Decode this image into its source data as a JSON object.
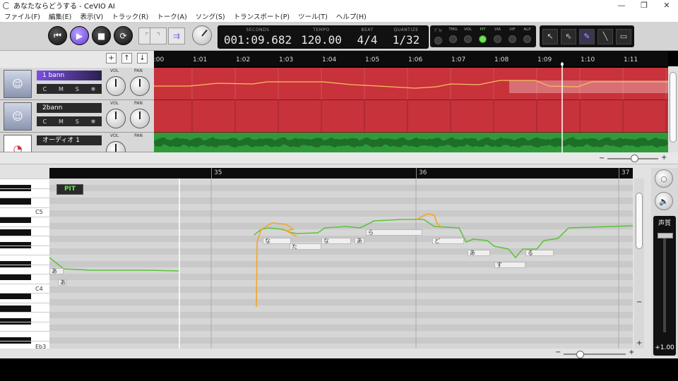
{
  "window": {
    "title": "あなたならどうする - CeVIO AI",
    "minimize": "—",
    "maximize": "❐",
    "close": "✕"
  },
  "menu": [
    "ファイル(F)",
    "編集(E)",
    "表示(V)",
    "トラック(R)",
    "トーク(A)",
    "ソング(S)",
    "トランスポート(P)",
    "ツール(T)",
    "ヘルプ(H)"
  ],
  "transport": {
    "seconds_label": "SECONDS",
    "seconds": "001:09.682",
    "tempo_label": "TEMPO",
    "tempo": "120.00",
    "beat_label": "BEAT",
    "beat": "4/4",
    "quantize_label": "QUANTIZE",
    "quantize": "1/32"
  },
  "toggles": [
    {
      "label": "ﾃﾞﾌｫ",
      "on": false
    },
    {
      "label": "TMG",
      "on": false
    },
    {
      "label": "VOL",
      "on": false
    },
    {
      "label": "PIT",
      "on": true
    },
    {
      "label": "VIA",
      "on": false
    },
    {
      "label": "VIF",
      "on": false
    },
    {
      "label": "ALP",
      "on": false
    }
  ],
  "track_buttons": {
    "add": "+",
    "up": "↑",
    "down": "↓"
  },
  "ruler": [
    "1:00",
    "1:01",
    "1:02",
    "1:03",
    "1:04",
    "1:05",
    "1:06",
    "1:07",
    "1:08",
    "1:09",
    "1:10",
    "1:11"
  ],
  "tracks": [
    {
      "name": "1 bann",
      "selected": true,
      "vol": "VOL",
      "pan": "PAN"
    },
    {
      "name": "2bann",
      "selected": false,
      "vol": "VOL",
      "pan": "PAN"
    },
    {
      "name": "オーディオ 1",
      "selected": false,
      "vol": "VOL",
      "pan": "PAN"
    }
  ],
  "track_controls": {
    "c": "C",
    "m": "M",
    "s": "S"
  },
  "roll": {
    "measures": [
      "35",
      "36",
      "37"
    ],
    "mode": "PIT",
    "key_labels": [
      "C5",
      "C4",
      "Eb3"
    ],
    "notes": [
      {
        "lyric": "あ"
      },
      {
        "lyric": "あ"
      },
      {
        "lyric": "な"
      },
      {
        "lyric": "た"
      },
      {
        "lyric": "な"
      },
      {
        "lyric": "あ"
      },
      {
        "lyric": "ら"
      },
      {
        "lyric": "ど"
      },
      {
        "lyric": "あ"
      },
      {
        "lyric": "す"
      },
      {
        "lyric": "る"
      }
    ]
  },
  "quality": {
    "label": "声質",
    "value": "+1.00"
  },
  "colors": {
    "track_red": "#c8323a",
    "track_green": "#2f9a3a",
    "pitch_line": "#5cc43c",
    "pitch_edit": "#f2a62a",
    "accent": "#7a50e0"
  }
}
